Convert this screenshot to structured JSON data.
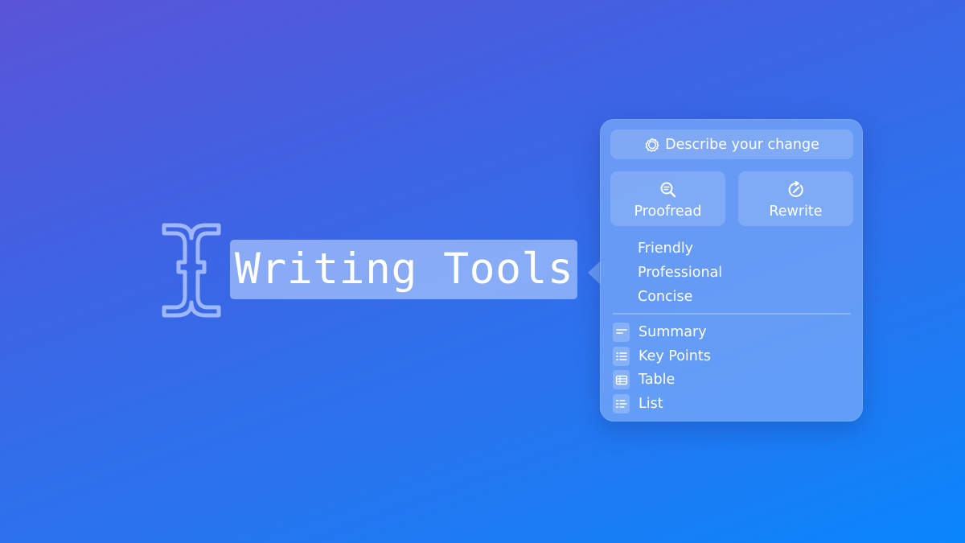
{
  "selection": {
    "text": "Writing Tools"
  },
  "cursor_icon": "text-insertion-cursor-icon",
  "popover": {
    "describe_placeholder": "Describe your change",
    "describe_icon": "sparkle-outline-icon",
    "actions": [
      {
        "label": "Proofread",
        "icon": "magnifier-text-icon"
      },
      {
        "label": "Rewrite",
        "icon": "circular-arrow-pencil-icon"
      }
    ],
    "tones": [
      "Friendly",
      "Professional",
      "Concise"
    ],
    "formats": [
      {
        "label": "Summary",
        "icon": "summary-lines-icon"
      },
      {
        "label": "Key Points",
        "icon": "bulleted-list-icon"
      },
      {
        "label": "Table",
        "icon": "table-grid-icon"
      },
      {
        "label": "List",
        "icon": "numbered-list-icon"
      }
    ]
  },
  "colors": {
    "background_start": "#5a54d8",
    "background_end": "#0a86fc",
    "popover_fill": "#7aaaf8",
    "selection_fill": "#a0befa",
    "text": "#ffffff"
  }
}
